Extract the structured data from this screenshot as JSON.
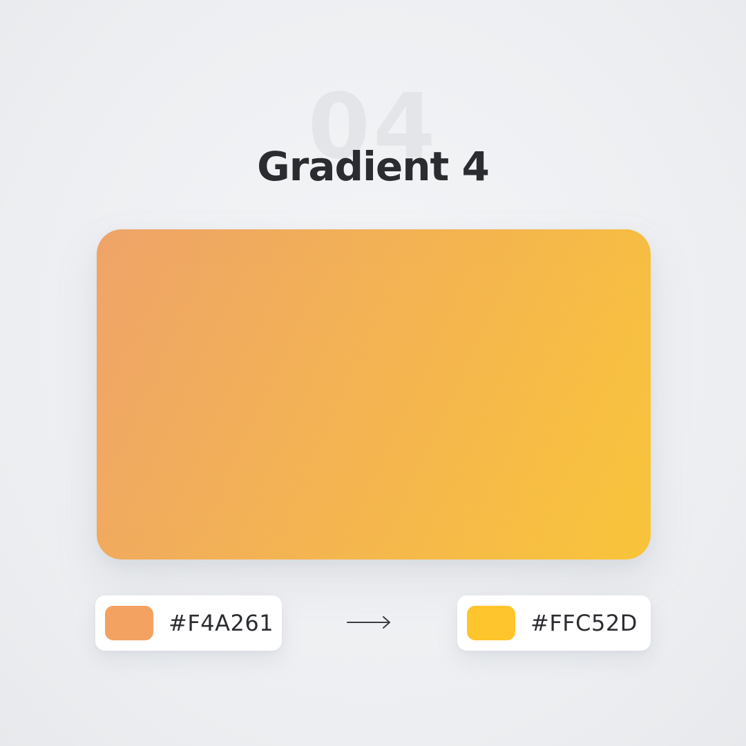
{
  "background_number": "04",
  "title": "Gradient 4",
  "gradient": {
    "start_color": "#F4A261",
    "end_color": "#FFC52D"
  },
  "start_chip": {
    "hex": "#F4A261",
    "color": "#F4A261"
  },
  "end_chip": {
    "hex": "#FFC52D",
    "color": "#FFC52D"
  },
  "icons": {
    "arrow": "arrow-right-icon"
  }
}
